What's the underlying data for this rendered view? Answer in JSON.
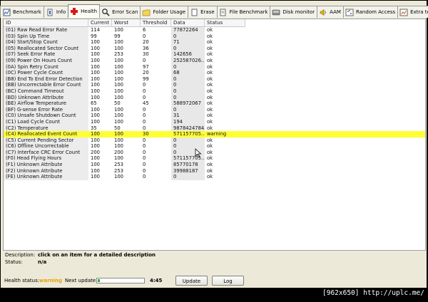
{
  "tabs": [
    {
      "label": "Benchmark",
      "icon": "benchmark-icon",
      "active": false
    },
    {
      "label": "Info",
      "icon": "info-icon",
      "active": false
    },
    {
      "label": "Health",
      "icon": "health-cross-icon",
      "active": true
    },
    {
      "label": "Error Scan",
      "icon": "error-scan-icon",
      "active": false
    },
    {
      "label": "Folder Usage",
      "icon": "folder-icon",
      "active": false
    },
    {
      "label": "Erase",
      "icon": "erase-icon",
      "active": false
    },
    {
      "label": "File Benchmark",
      "icon": "file-benchmark-icon",
      "active": false
    },
    {
      "label": "Disk monitor",
      "icon": "disk-monitor-icon",
      "active": false
    },
    {
      "label": "AAM",
      "icon": "speaker-icon",
      "active": false
    },
    {
      "label": "Random Access",
      "icon": "random-access-icon",
      "active": false
    },
    {
      "label": "Extra tests",
      "icon": "extra-tests-icon",
      "active": false
    }
  ],
  "table": {
    "headers": [
      "ID",
      "Current",
      "Worst",
      "Threshold",
      "Data",
      "Status"
    ],
    "rows": [
      [
        "(01) Raw Read Error Rate",
        "114",
        "100",
        "6",
        "77872264",
        "ok"
      ],
      [
        "(03) Spin Up Time",
        "99",
        "99",
        "0",
        "0",
        "ok"
      ],
      [
        "(04) Start/Stop Count",
        "100",
        "100",
        "20",
        "71",
        "ok"
      ],
      [
        "(05) Reallocated Sector Count",
        "100",
        "100",
        "36",
        "0",
        "ok"
      ],
      [
        "(07) Seek Error Rate",
        "100",
        "253",
        "30",
        "142656",
        "ok"
      ],
      [
        "(09) Power On Hours Count",
        "100",
        "100",
        "0",
        "252587026...",
        "ok"
      ],
      [
        "(0A) Spin Retry Count",
        "100",
        "100",
        "97",
        "0",
        "ok"
      ],
      [
        "(0C) Power Cycle Count",
        "100",
        "100",
        "20",
        "68",
        "ok"
      ],
      [
        "(B8) End To End Error Detection",
        "100",
        "100",
        "99",
        "0",
        "ok"
      ],
      [
        "(BB) Uncorrectable Error Count",
        "100",
        "100",
        "0",
        "0",
        "ok"
      ],
      [
        "(BC) Command Timeout",
        "100",
        "100",
        "0",
        "0",
        "ok"
      ],
      [
        "(BD) Unknown Attribute",
        "100",
        "100",
        "0",
        "0",
        "ok"
      ],
      [
        "(BE) Airflow Temperature",
        "65",
        "50",
        "45",
        "588972067",
        "ok"
      ],
      [
        "(BF) G-sense Error Rate",
        "100",
        "100",
        "0",
        "0",
        "ok"
      ],
      [
        "(C0) Unsafe Shutdown Count",
        "100",
        "100",
        "0",
        "31",
        "ok"
      ],
      [
        "(C1) Load Cycle Count",
        "100",
        "100",
        "0",
        "194",
        "ok"
      ],
      [
        "(C2) Temperature",
        "35",
        "50",
        "0",
        "98784247843",
        "ok"
      ],
      [
        "(C4) Reallocated Event Count",
        "100",
        "100",
        "30",
        "571157705...",
        "warning"
      ],
      [
        "(C5) Current Pending Sector",
        "100",
        "100",
        "0",
        "0",
        "ok"
      ],
      [
        "(C6) Offline Uncorrectable",
        "100",
        "100",
        "0",
        "0",
        "ok"
      ],
      [
        "(C7) Interface CRC Error Count",
        "200",
        "200",
        "0",
        "0",
        "ok"
      ],
      [
        "(F0) Head Flying Hours",
        "100",
        "100",
        "0",
        "571157705...",
        "ok"
      ],
      [
        "(F1) Unknown Attribute",
        "100",
        "253",
        "0",
        "85770178",
        "ok"
      ],
      [
        "(F2) Unknown Attribute",
        "100",
        "253",
        "0",
        "39988187",
        "ok"
      ],
      [
        "(FE) Unknown Attribute",
        "100",
        "100",
        "0",
        "0",
        "ok"
      ]
    ],
    "warning_color": "#ffff33"
  },
  "description": {
    "label": "Description:",
    "value": "click on an item for a detailed description"
  },
  "status": {
    "label": "Status:",
    "value": "n/a"
  },
  "bottom": {
    "health_label": "Health status:",
    "health_value": "warning",
    "health_color": "#e8a000",
    "next_update_label": "Next update:",
    "progress_fraction": 0.04,
    "countdown": "4:45",
    "update_button": "Update",
    "log_button": "Log"
  },
  "footer_text": "[962x650] http://uplc.me/"
}
